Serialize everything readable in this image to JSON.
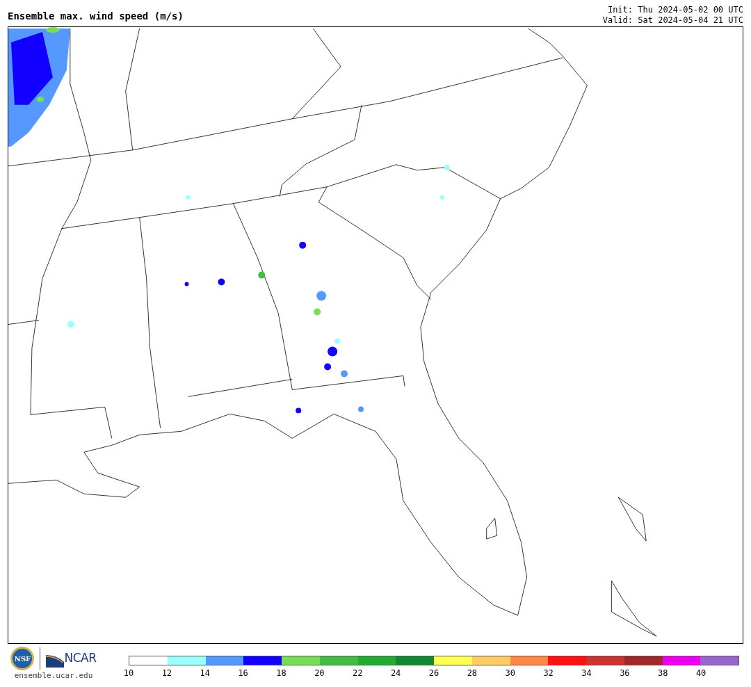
{
  "title": "Ensemble max. wind speed (m/s)",
  "init": "Init: Thu 2024-05-02 00 UTC",
  "valid": "Valid: Sat 2024-05-04 21 UTC",
  "logos": {
    "nsf": "NSF",
    "ncar": "NCAR",
    "url": "ensemble.ucar.edu"
  },
  "legend": {
    "bins": [
      {
        "color": "#ffffff",
        "label": "10"
      },
      {
        "color": "#99ffff",
        "label": "12"
      },
      {
        "color": "#5599ff",
        "label": "14"
      },
      {
        "color": "#1100ff",
        "label": "16"
      },
      {
        "color": "#77dd55",
        "label": "18"
      },
      {
        "color": "#44bb44",
        "label": "20"
      },
      {
        "color": "#22aa33",
        "label": "22"
      },
      {
        "color": "#118833",
        "label": "24"
      },
      {
        "color": "#ffff55",
        "label": "26"
      },
      {
        "color": "#ffcc66",
        "label": "28"
      },
      {
        "color": "#ff8844",
        "label": "30"
      },
      {
        "color": "#ff1111",
        "label": "32"
      },
      {
        "color": "#cc3333",
        "label": "34"
      },
      {
        "color": "#a02828",
        "label": "36"
      },
      {
        "color": "#ee00ee",
        "label": "38"
      },
      {
        "color": "#9966cc",
        "label": "40"
      }
    ]
  }
}
